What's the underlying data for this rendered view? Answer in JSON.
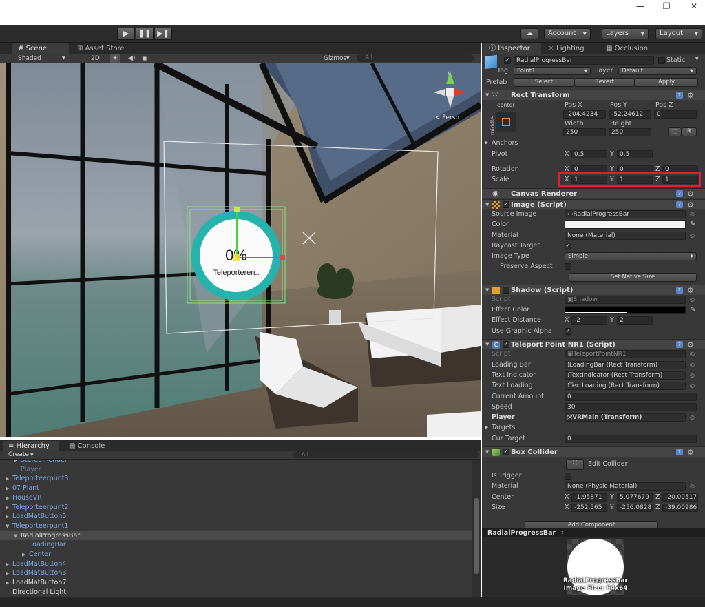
{
  "window": {
    "minimize": "—",
    "restore": "❐",
    "close": "✕"
  },
  "toolbar": {
    "play": "▶",
    "pause": "❚❚",
    "step": "▶❚",
    "cloud": "☁",
    "account": "Account",
    "layers": "Layers",
    "layout": "Layout"
  },
  "scene": {
    "tabs": [
      "Scene",
      "Asset Store"
    ],
    "shading": "Shaded",
    "mode_2d": "2D",
    "gizmos": "Gizmos",
    "search_placeholder": "All",
    "persp_label": "< Persp",
    "progress_text": "0%",
    "teleport_text": "Teleporteren.."
  },
  "hierarchy": {
    "tabs": [
      "Hierarchy",
      "Console"
    ],
    "create": "Create",
    "search_placeholder": "All",
    "items": [
      {
        "label": "Stereo Render",
        "indent": 2,
        "style": "blue",
        "arrow": "▶"
      },
      {
        "label": "Player",
        "indent": 2,
        "style": "grey",
        "arrow": ""
      },
      {
        "label": "Teleporteerpunt3",
        "indent": 1,
        "style": "blue",
        "arrow": "▶"
      },
      {
        "label": "07 Plant",
        "indent": 1,
        "style": "blue",
        "arrow": "▶"
      },
      {
        "label": "HouseVR",
        "indent": 1,
        "style": "blue",
        "arrow": "▶"
      },
      {
        "label": "Teleporteerpunt2",
        "indent": 1,
        "style": "blue",
        "arrow": "▶"
      },
      {
        "label": "LoadMatButton5",
        "indent": 1,
        "style": "blue",
        "arrow": "▶"
      },
      {
        "label": "Teleporteerpunt1",
        "indent": 1,
        "style": "blue",
        "arrow": "▼"
      },
      {
        "label": "RadialProgressBar",
        "indent": 2,
        "style": "white",
        "arrow": "▼",
        "selected": true
      },
      {
        "label": "LoadingBar",
        "indent": 3,
        "style": "blue",
        "arrow": ""
      },
      {
        "label": "Center",
        "indent": 3,
        "style": "blue",
        "arrow": "▶"
      },
      {
        "label": "LoadMatButton4",
        "indent": 1,
        "style": "blue",
        "arrow": "▶"
      },
      {
        "label": "LoadMatButton3",
        "indent": 1,
        "style": "blue",
        "arrow": "▶"
      },
      {
        "label": "LoadMatButton7",
        "indent": 1,
        "style": "white",
        "arrow": "▶"
      },
      {
        "label": "Directional Light",
        "indent": 1,
        "style": "white",
        "arrow": ""
      }
    ]
  },
  "inspector": {
    "tabs": [
      "Inspector",
      "Lighting",
      "Occlusion"
    ],
    "object_name": "RadialProgressBar",
    "static_label": "Static",
    "tag_label": "Tag",
    "tag_value": "Point1",
    "layer_label": "Layer",
    "layer_value": "Default",
    "prefab_label": "Prefab",
    "prefab_select": "Select",
    "prefab_revert": "Revert",
    "prefab_apply": "Apply",
    "rect_transform": {
      "title": "Rect Transform",
      "anchor_h": "center",
      "anchor_v": "middle",
      "pos_x_label": "Pos X",
      "pos_y_label": "Pos Y",
      "pos_z_label": "Pos Z",
      "pos_x": "-204.4234",
      "pos_y": "-52.24612",
      "pos_z": "0",
      "width_label": "Width",
      "height_label": "Height",
      "width": "250",
      "height": "250",
      "r_btn": "R",
      "anchors_label": "Anchors",
      "pivot_label": "Pivot",
      "pivot_x": "0.5",
      "pivot_y": "0.5",
      "rotation_label": "Rotation",
      "rot_x": "0",
      "rot_y": "0",
      "rot_z": "0",
      "scale_label": "Scale",
      "scale_x": "1",
      "scale_y": "1",
      "scale_z": "1"
    },
    "canvas_renderer": {
      "title": "Canvas Renderer"
    },
    "image": {
      "title": "Image (Script)",
      "source_image_label": "Source Image",
      "source_image": "RadialProgressBar",
      "color_label": "Color",
      "material_label": "Material",
      "material": "None (Material)",
      "raycast_label": "Raycast Target",
      "image_type_label": "Image Type",
      "image_type": "Simple",
      "preserve_label": "Preserve Aspect",
      "native_size": "Set Native Size"
    },
    "shadow": {
      "title": "Shadow (Script)",
      "script_label": "Script",
      "script": "Shadow",
      "effect_color_label": "Effect Color",
      "effect_distance_label": "Effect Distance",
      "dist_x": "-2",
      "dist_y": "2",
      "graphic_alpha_label": "Use Graphic Alpha"
    },
    "teleport": {
      "title": "Teleport Point NR1 (Script)",
      "script_label": "Script",
      "script": "TeleportPointNR1",
      "loading_bar_label": "Loading Bar",
      "loading_bar": "LoadingBar (Rect Transform)",
      "text_indicator_label": "Text Indicator",
      "text_indicator": "TextIndicator (Rect Transform)",
      "text_loading_label": "Text Loading",
      "text_loading": "TextLoading (Rect Transform)",
      "current_amount_label": "Current Amount",
      "current_amount": "0",
      "speed_label": "Speed",
      "speed": "30",
      "player_label": "Player",
      "player": "VRMain (Transform)",
      "targets_label": "Targets",
      "cur_target_label": "Cur Target",
      "cur_target": "0"
    },
    "box_collider": {
      "title": "Box Collider",
      "edit_collider": "Edit Collider",
      "is_trigger_label": "Is Trigger",
      "material_label": "Material",
      "material": "None (Physic Material)",
      "center_label": "Center",
      "center_x": "-1.95871",
      "center_y": "5.077679",
      "center_z": "-20.00517",
      "size_label": "Size",
      "size_x": "-252.565",
      "size_y": "-256.0828",
      "size_z": "-39.00986"
    },
    "add_component": "Add Component",
    "axis_x": "X",
    "axis_y": "Y",
    "axis_z": "Z",
    "checkmark": "✓"
  },
  "preview": {
    "header": "RadialProgressBar",
    "name": "RadialProgressBar",
    "image_size": "Image Size: 64x64"
  },
  "colors": {
    "editor_bg": "#383838",
    "ring": "#26b3ab",
    "highlight": "#e0202a",
    "link_blue": "#7fa6e6"
  }
}
